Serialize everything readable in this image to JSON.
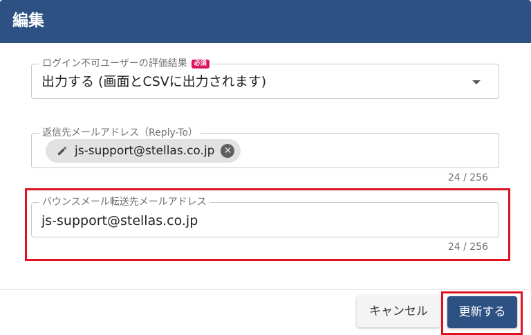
{
  "dialog": {
    "title": "編集"
  },
  "login_disabled_field": {
    "label": "ログイン不可ユーザーの評価結果",
    "required_badge": "必須",
    "value": "出力する (画面とCSVに出力されます)"
  },
  "reply_to_field": {
    "label": "返信先メールアドレス（Reply-To）",
    "chip_value": "js-support@stellas.co.jp",
    "counter": "24 / 256"
  },
  "bounce_field": {
    "label": "バウンスメール転送先メールアドレス",
    "value": "js-support@stellas.co.jp",
    "counter": "24 / 256"
  },
  "actions": {
    "cancel_label": "キャンセル",
    "submit_label": "更新する"
  },
  "colors": {
    "header": "#2c5182",
    "primary_button": "#2c5182",
    "required_badge": "#d8175e",
    "highlight": "#e0111f"
  }
}
